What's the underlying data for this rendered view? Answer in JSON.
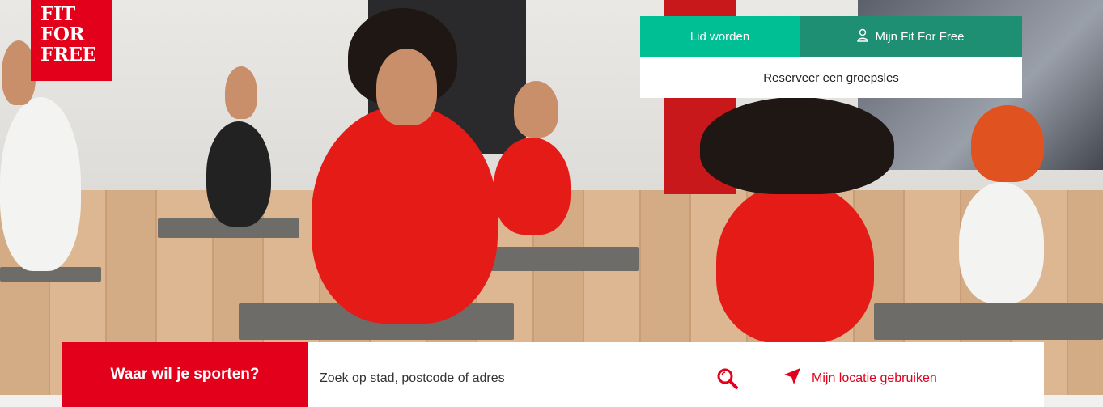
{
  "logo": {
    "line1": "FIT",
    "line2": "FOR",
    "line3": "FREE"
  },
  "nav": {
    "join_label": "Lid worden",
    "member_label": "Mijn Fit For Free",
    "reserve_label": "Reserveer een groepsles"
  },
  "search": {
    "heading": "Waar wil je sporten?",
    "placeholder": "Zoek op stad, postcode of adres",
    "location_label": "Mijn locatie gebruiken"
  },
  "colors": {
    "brand_red": "#e2001a",
    "green": "#00bf95",
    "dark_green": "#1e8f73"
  },
  "icons": {
    "member": "user-icon",
    "search": "search-icon",
    "location": "location-arrow-icon"
  }
}
